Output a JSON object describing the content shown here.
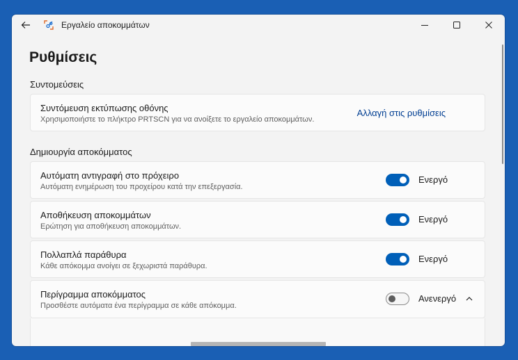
{
  "window": {
    "title": "Εργαλείο αποκομμάτων",
    "back_icon": "arrow-left-icon",
    "app_icon": "snipping-tool-icon",
    "controls": [
      "minimize-icon",
      "maximize-icon",
      "close-icon"
    ]
  },
  "page": {
    "title": "Ρυθμίσεις"
  },
  "shortcuts": {
    "header": "Συντομεύσεις",
    "printscreen": {
      "title": "Συντόμευση εκτύπωσης οθόνης",
      "desc": "Χρησιμοποιήστε το πλήκτρο PRTSCN για να ανοίξετε το εργαλείο αποκομμάτων.",
      "action": "Αλλαγή στις ρυθμίσεις"
    }
  },
  "snipping": {
    "header": "Δημιουργία αποκόμματος",
    "items": [
      {
        "title": "Αυτόματη αντιγραφή στο πρόχειρο",
        "desc": "Αυτόματη ενημέρωση του προχείρου κατά την επεξεργασία.",
        "state": "Ενεργό",
        "on": true
      },
      {
        "title": "Αποθήκευση αποκομμάτων",
        "desc": "Ερώτηση για αποθήκευση αποκομμάτων.",
        "state": "Ενεργό",
        "on": true
      },
      {
        "title": "Πολλαπλά παράθυρα",
        "desc": "Κάθε απόκομμα ανοίγει σε ξεχωριστά παράθυρα.",
        "state": "Ενεργό",
        "on": true
      },
      {
        "title": "Περίγραμμα αποκόμματος",
        "desc": "Προσθέστε αυτόματα ένα περίγραμμα σε κάθε απόκομμα.",
        "state": "Ανενεργό",
        "on": false
      }
    ]
  },
  "colors": {
    "accent": "#005fb8",
    "link": "#003e92",
    "desktop": "#1a5fb4",
    "window_bg": "#f3f3f3",
    "card_bg": "#fbfbfb"
  }
}
